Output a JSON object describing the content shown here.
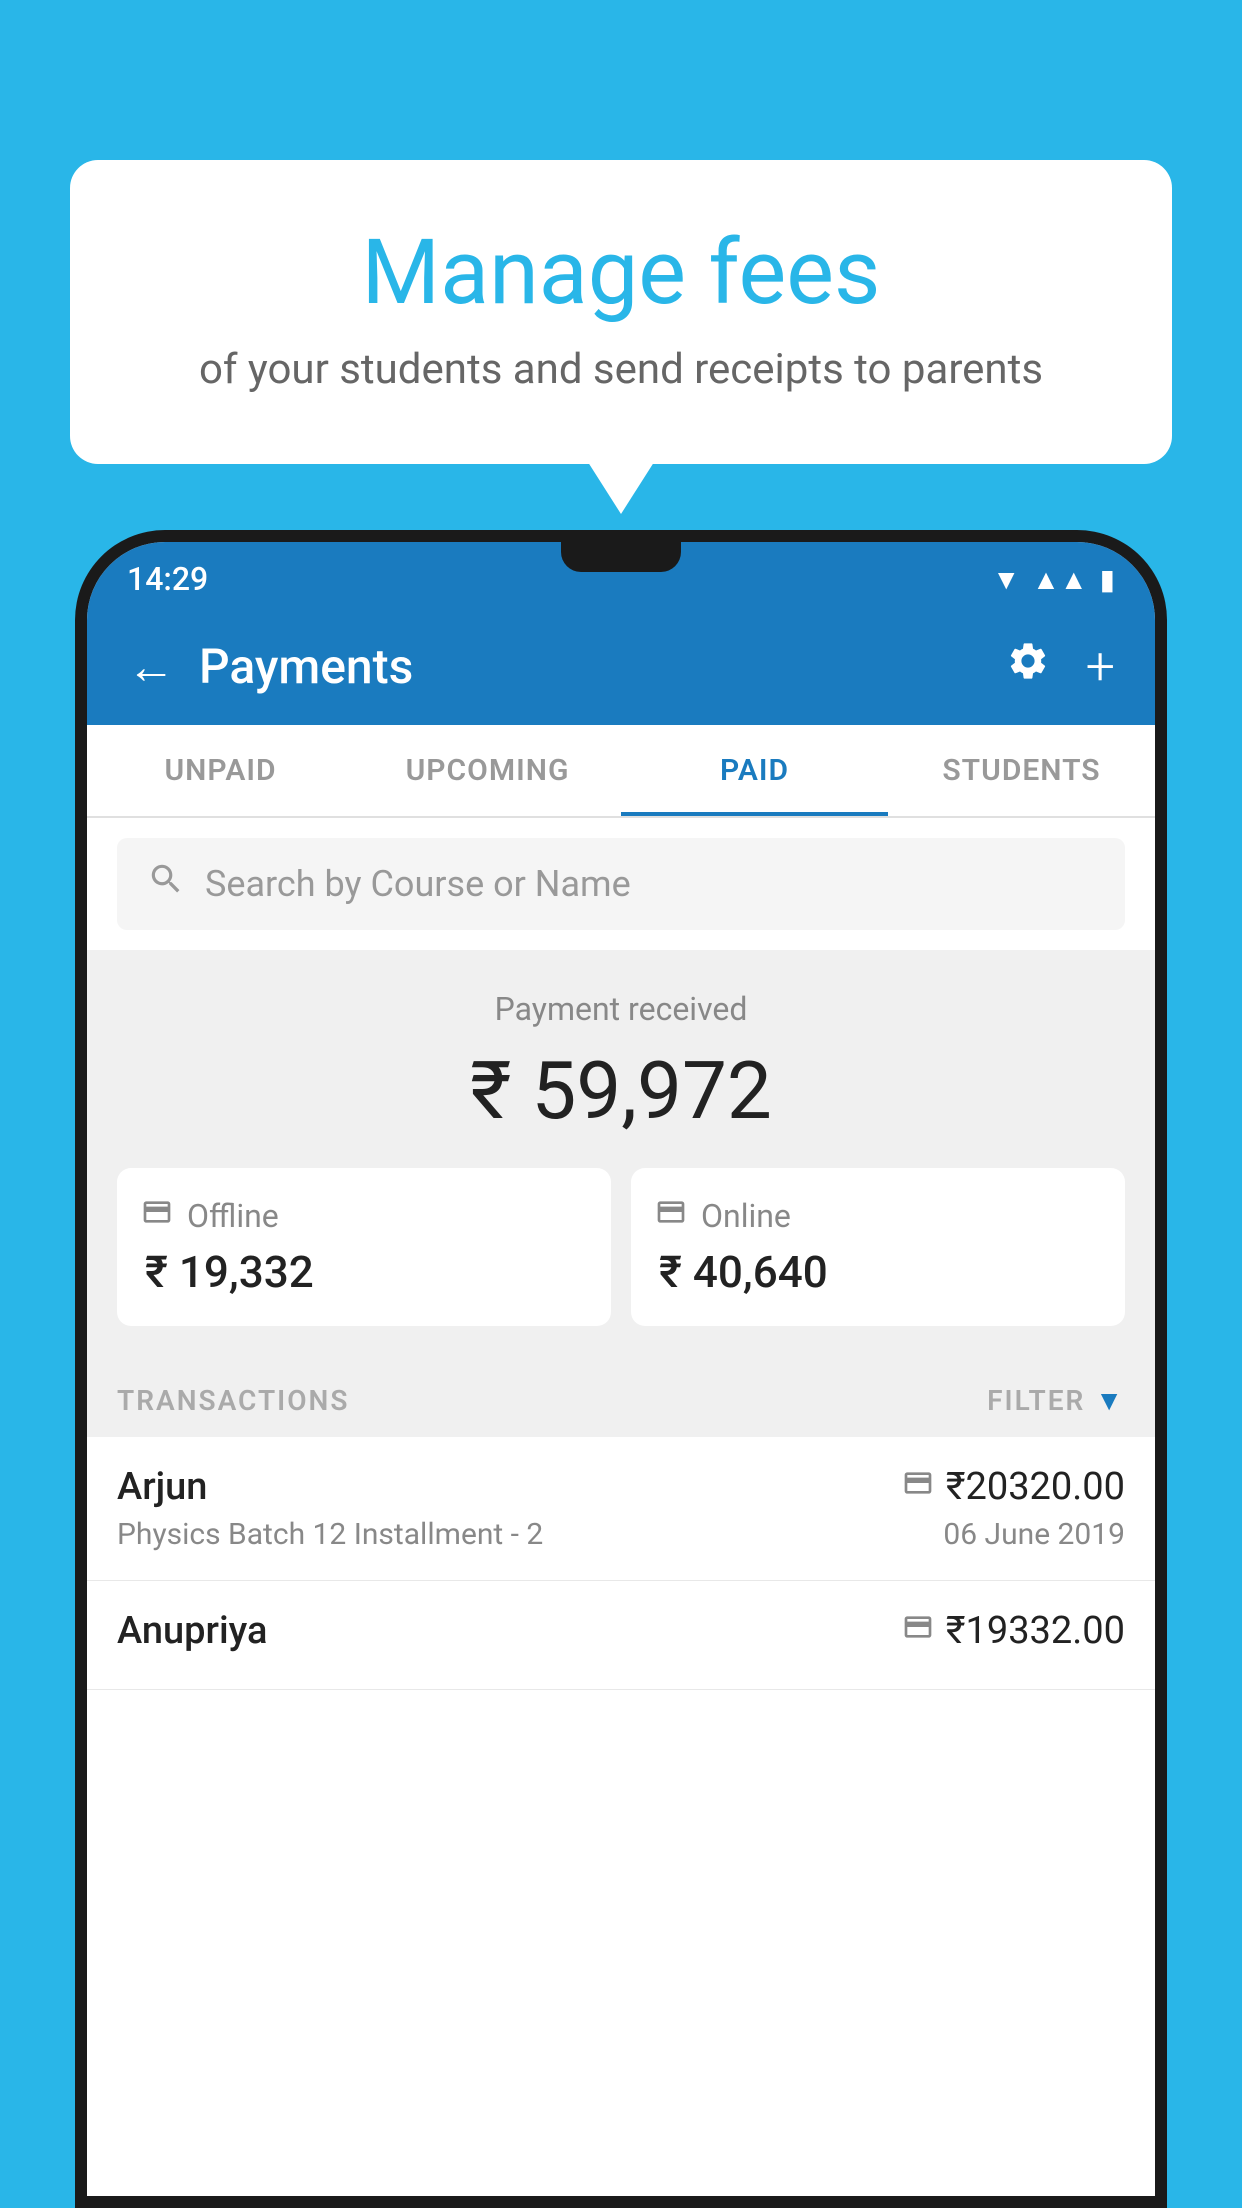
{
  "background_color": "#29b6e8",
  "speech_bubble": {
    "title": "Manage fees",
    "subtitle": "of your students and send receipts to parents"
  },
  "status_bar": {
    "time": "14:29",
    "icons": [
      "wifi",
      "signal",
      "battery"
    ]
  },
  "app_bar": {
    "title": "Payments",
    "back_label": "←",
    "settings_label": "⚙",
    "add_label": "+"
  },
  "tabs": [
    {
      "id": "unpaid",
      "label": "UNPAID",
      "active": false
    },
    {
      "id": "upcoming",
      "label": "UPCOMING",
      "active": false
    },
    {
      "id": "paid",
      "label": "PAID",
      "active": true
    },
    {
      "id": "students",
      "label": "STUDENTS",
      "active": false
    }
  ],
  "search": {
    "placeholder": "Search by Course or Name"
  },
  "payment_summary": {
    "label": "Payment received",
    "total": "₹ 59,972",
    "offline_label": "Offline",
    "offline_amount": "₹ 19,332",
    "online_label": "Online",
    "online_amount": "₹ 40,640"
  },
  "transactions": {
    "header_label": "TRANSACTIONS",
    "filter_label": "FILTER",
    "items": [
      {
        "name": "Arjun",
        "amount": "₹20320.00",
        "type": "online",
        "detail": "Physics Batch 12 Installment - 2",
        "date": "06 June 2019"
      },
      {
        "name": "Anupriya",
        "amount": "₹19332.00",
        "type": "offline",
        "detail": "",
        "date": ""
      }
    ]
  }
}
